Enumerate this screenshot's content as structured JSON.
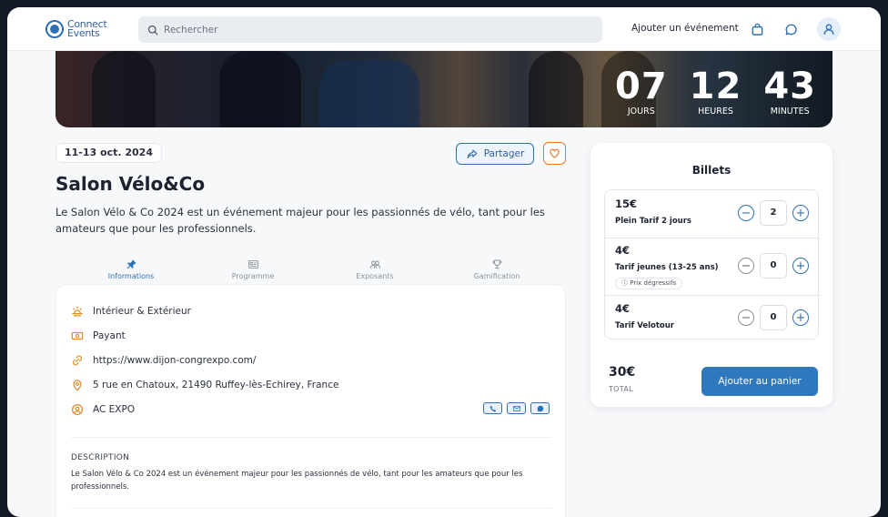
{
  "brand": {
    "name_line1": "Connect",
    "name_line2": "Events",
    "color": "#2f6fb4"
  },
  "header": {
    "search_placeholder": "Rechercher",
    "add_event_label": "Ajouter un événement"
  },
  "countdown": [
    {
      "value": "07",
      "label": "JOURS"
    },
    {
      "value": "12",
      "label": "HEURES"
    },
    {
      "value": "43",
      "label": "MINUTES"
    }
  ],
  "event": {
    "date": "11-13 oct. 2024",
    "share_label": "Partager",
    "title": "Salon Vélo&Co",
    "lead": "Le Salon Vélo & Co 2024 est un événement majeur pour les passionnés de vélo, tant pour les amateurs que pour les professionnels."
  },
  "tabs": [
    {
      "label": "Informations",
      "icon": "pin-icon",
      "active": true
    },
    {
      "label": "Programme",
      "icon": "program-icon",
      "active": false
    },
    {
      "label": "Exposants",
      "icon": "users-icon",
      "active": false
    },
    {
      "label": "Gamification",
      "icon": "trophy-icon",
      "active": false
    }
  ],
  "info": {
    "venue_type": "Intérieur & Extérieur",
    "pricing": "Payant",
    "website": "https://www.dijon-congrexpo.com/",
    "address": "5 rue en Chatoux, 21490 Ruffey-lès-Echirey, France",
    "organizer": "AC EXPO",
    "description_label": "DESCRIPTION",
    "description": "Le Salon Vélo & Co 2024 est un événement majeur pour les passionnés de vélo, tant pour les amateurs que pour les professionnels."
  },
  "tickets": {
    "title": "Billets",
    "items": [
      {
        "price": "15€",
        "name": "Plein Tarif 2 jours",
        "quantity": "2",
        "badge": ""
      },
      {
        "price": "4€",
        "name": "Tarif jeunes (13-25 ans)",
        "quantity": "0",
        "badge": "Prix dégressifs"
      },
      {
        "price": "4€",
        "name": "Tarif Velotour",
        "quantity": "0",
        "badge": ""
      }
    ],
    "total_amount": "30€",
    "total_label": "TOTAL",
    "add_to_cart_label": "Ajouter au panier"
  }
}
